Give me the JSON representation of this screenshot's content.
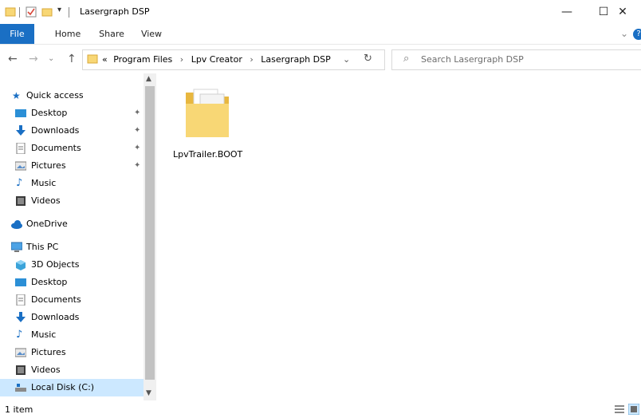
{
  "window": {
    "title": "Lasergraph DSP",
    "minimize_glyph": "—",
    "maximize_glyph": "☐",
    "close_glyph": "✕",
    "qa_dropdown_glyph": "▾"
  },
  "ribbon": {
    "tabs": [
      {
        "label": "File",
        "active": true
      },
      {
        "label": "Home"
      },
      {
        "label": "Share"
      },
      {
        "label": "View"
      }
    ],
    "expand_glyph": "⌄",
    "help_glyph": "?"
  },
  "nav_buttons": {
    "back": "←",
    "forward": "→",
    "up": "↑",
    "dropdown": "⌄",
    "refresh": "↻"
  },
  "address": {
    "overflow": "«",
    "crumbs": [
      "Program Files",
      "Lpv Creator",
      "Lasergraph DSP"
    ],
    "chevron": "›"
  },
  "search": {
    "placeholder": "Search Lasergraph DSP",
    "glyph": "⌕"
  },
  "sidebar": {
    "quick_access": "Quick access",
    "quick_items": [
      {
        "label": "Desktop",
        "pinned": true
      },
      {
        "label": "Downloads",
        "pinned": true
      },
      {
        "label": "Documents",
        "pinned": true
      },
      {
        "label": "Pictures",
        "pinned": true
      },
      {
        "label": "Music"
      },
      {
        "label": "Videos"
      }
    ],
    "onedrive": "OneDrive",
    "this_pc": "This PC",
    "pc_items": [
      "3D Objects",
      "Desktop",
      "Documents",
      "Downloads",
      "Music",
      "Pictures",
      "Videos",
      "Local Disk (C:)"
    ],
    "pin_glyph": "✦",
    "scroll_up": "▲",
    "scroll_down": "▼"
  },
  "content": {
    "items": [
      {
        "name": "LpvTrailer.BOOT",
        "icon": "folder-icon"
      }
    ]
  },
  "status": {
    "count_text": "1 item"
  },
  "colors": {
    "accent": "#1a6fc4",
    "selected": "#cce8ff",
    "folder": "#f8d775"
  }
}
